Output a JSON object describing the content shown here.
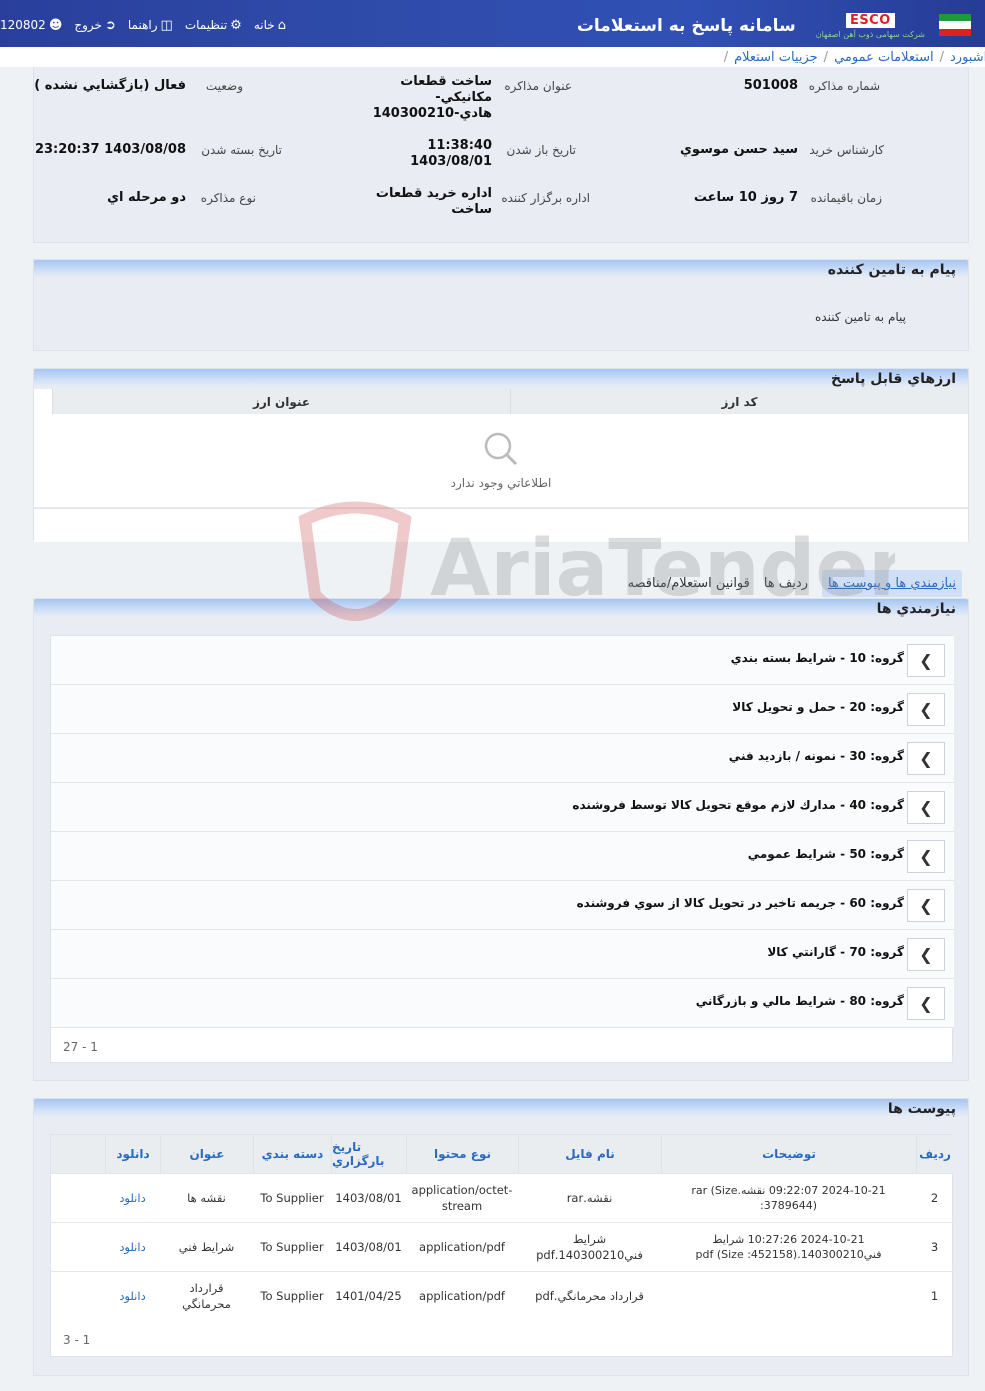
{
  "topbar": {
    "app_title": "سامانه پاسخ به استعلامات",
    "esco": "ESCO",
    "esco_sub": "شرکت سهامی ذوب آهن اصفهان",
    "user_code": "120802",
    "logout": "خروج",
    "help": "راهنما",
    "settings": "تنظيمات",
    "home": "خانه"
  },
  "breadcrumb": {
    "item1": "داشبورد",
    "item2": "استعلامات عمومي",
    "item3": "جزييات استعلام",
    "sep": "/"
  },
  "details": {
    "num_label": "شماره مذاکره",
    "num": "501008",
    "title_label": "عنوان مذاکره",
    "title_l1": "ساخت قطعات",
    "title_l2": "مکانيکي-",
    "title_l3": "هادي-140300210",
    "status_label": "وضعيت",
    "status": "فعال (بازگشايي نشده )",
    "expert_label": "کارشناس خريد",
    "expert": "سيد حسن موسوي",
    "open_label": "تاريخ باز شدن",
    "open_time": "11:38:40",
    "open_date": "1403/08/01",
    "close_label": "تاريخ بسته شدن",
    "close": "1403/08/08 23:20:37",
    "remain_label": "زمان باقيمانده",
    "remain": "7 روز 10 ساعت",
    "org_label": "اداره برگزار کننده",
    "org_l1": "اداره خريد قطعات",
    "org_l2": "ساخت",
    "type_label": "نوع مذاکره",
    "type": "دو مرحله اي"
  },
  "supplier_msg": {
    "title": "پيام به تامين کننده",
    "text": "پيام به تامين کننده"
  },
  "currencies": {
    "title": "ارزهاي قابل پاسخ",
    "col_code": "کد ارز",
    "col_title": "عنوان ارز",
    "empty": "اطلاعاتي وجود ندارد"
  },
  "tabs": {
    "t1": "نيازمندي ها و پيوست ها",
    "t2": "رديف ها",
    "t3": "قوانين استعلام/مناقصه"
  },
  "requirements": {
    "title": "نيازمندي ها",
    "groups": [
      "گروه: 10 - شرايط بسته بندي",
      "گروه: 20 - حمل و تحويل کالا",
      "گروه: 30 - نمونه / بازديد فني",
      "گروه: 40 - مدارك لازم موقع تحويل کالا توسط فروشنده",
      "گروه: 50 - شرايط عمومي",
      "گروه: 60 - جريمه تاخير در تحويل کالا از سوي فروشنده",
      "گروه: 70 - گارانتي کالا",
      "گروه: 80 - شرايط مالي و بازرگاني"
    ],
    "pager": "1 - 27"
  },
  "attachments": {
    "title": "پيوست ها",
    "headers": {
      "row": "رديف",
      "desc": "توضيحات",
      "file": "نام فايل",
      "ctype": "نوع محتوا",
      "date": "تاريخ بارگزاري",
      "cat": "دسته بندي",
      "title": "عنوان",
      "dl": "دانلود"
    },
    "rows": [
      {
        "row": "2",
        "desc": "2024-10-21 09:22:07 نقشه.rar (Size :3789644)",
        "file": "نقشه.rar",
        "ctype": "application/octet-stream",
        "date": "1403/08/01",
        "cat": "To Supplier",
        "title": "نقشه ها",
        "dl": "دانلود"
      },
      {
        "row": "3",
        "desc": "2024-10-21 10:27:26 شرايط فني140300210.pdf (Size :452158)",
        "file": "شرايط فني140300210.pdf",
        "ctype": "application/pdf",
        "date": "1403/08/01",
        "cat": "To Supplier",
        "title": "شرايط فني",
        "dl": "دانلود"
      },
      {
        "row": "1",
        "desc": "",
        "file": "قرارداد محرمانگي.pdf",
        "ctype": "application/pdf",
        "date": "1401/04/25",
        "cat": "To Supplier",
        "title": "قرارداد محرمانگي",
        "dl": "دانلود"
      }
    ],
    "pager": "1 - 3"
  },
  "watermark": "AriaTender.neT"
}
